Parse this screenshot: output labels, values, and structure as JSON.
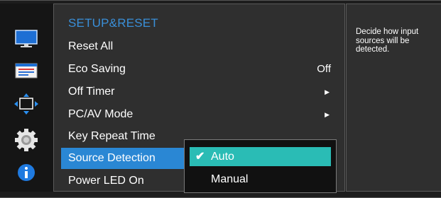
{
  "menu": {
    "title": "SETUP&RESET",
    "items": [
      {
        "label": "Reset All",
        "value": ""
      },
      {
        "label": "Eco Saving",
        "value": "Off"
      },
      {
        "label": "Off Timer",
        "arrow": "▶"
      },
      {
        "label": "PC/AV Mode",
        "arrow": "▶"
      },
      {
        "label": "Key Repeat Time"
      },
      {
        "label": "Source Detection"
      },
      {
        "label": "Power LED On"
      }
    ]
  },
  "submenu": {
    "options": [
      "Auto",
      "Manual"
    ],
    "selected": "Auto",
    "check": "✔"
  },
  "help": {
    "text": "Decide how input sources will be detected."
  },
  "sidebar": {
    "icons": [
      "picture-icon",
      "onscreen-display-icon",
      "position-icon",
      "setup-gear-icon",
      "information-icon"
    ]
  },
  "colors": {
    "accent_blue": "#2a87d4",
    "submenu_selected": "#2abcb5",
    "title_blue": "#3a8fd8"
  }
}
